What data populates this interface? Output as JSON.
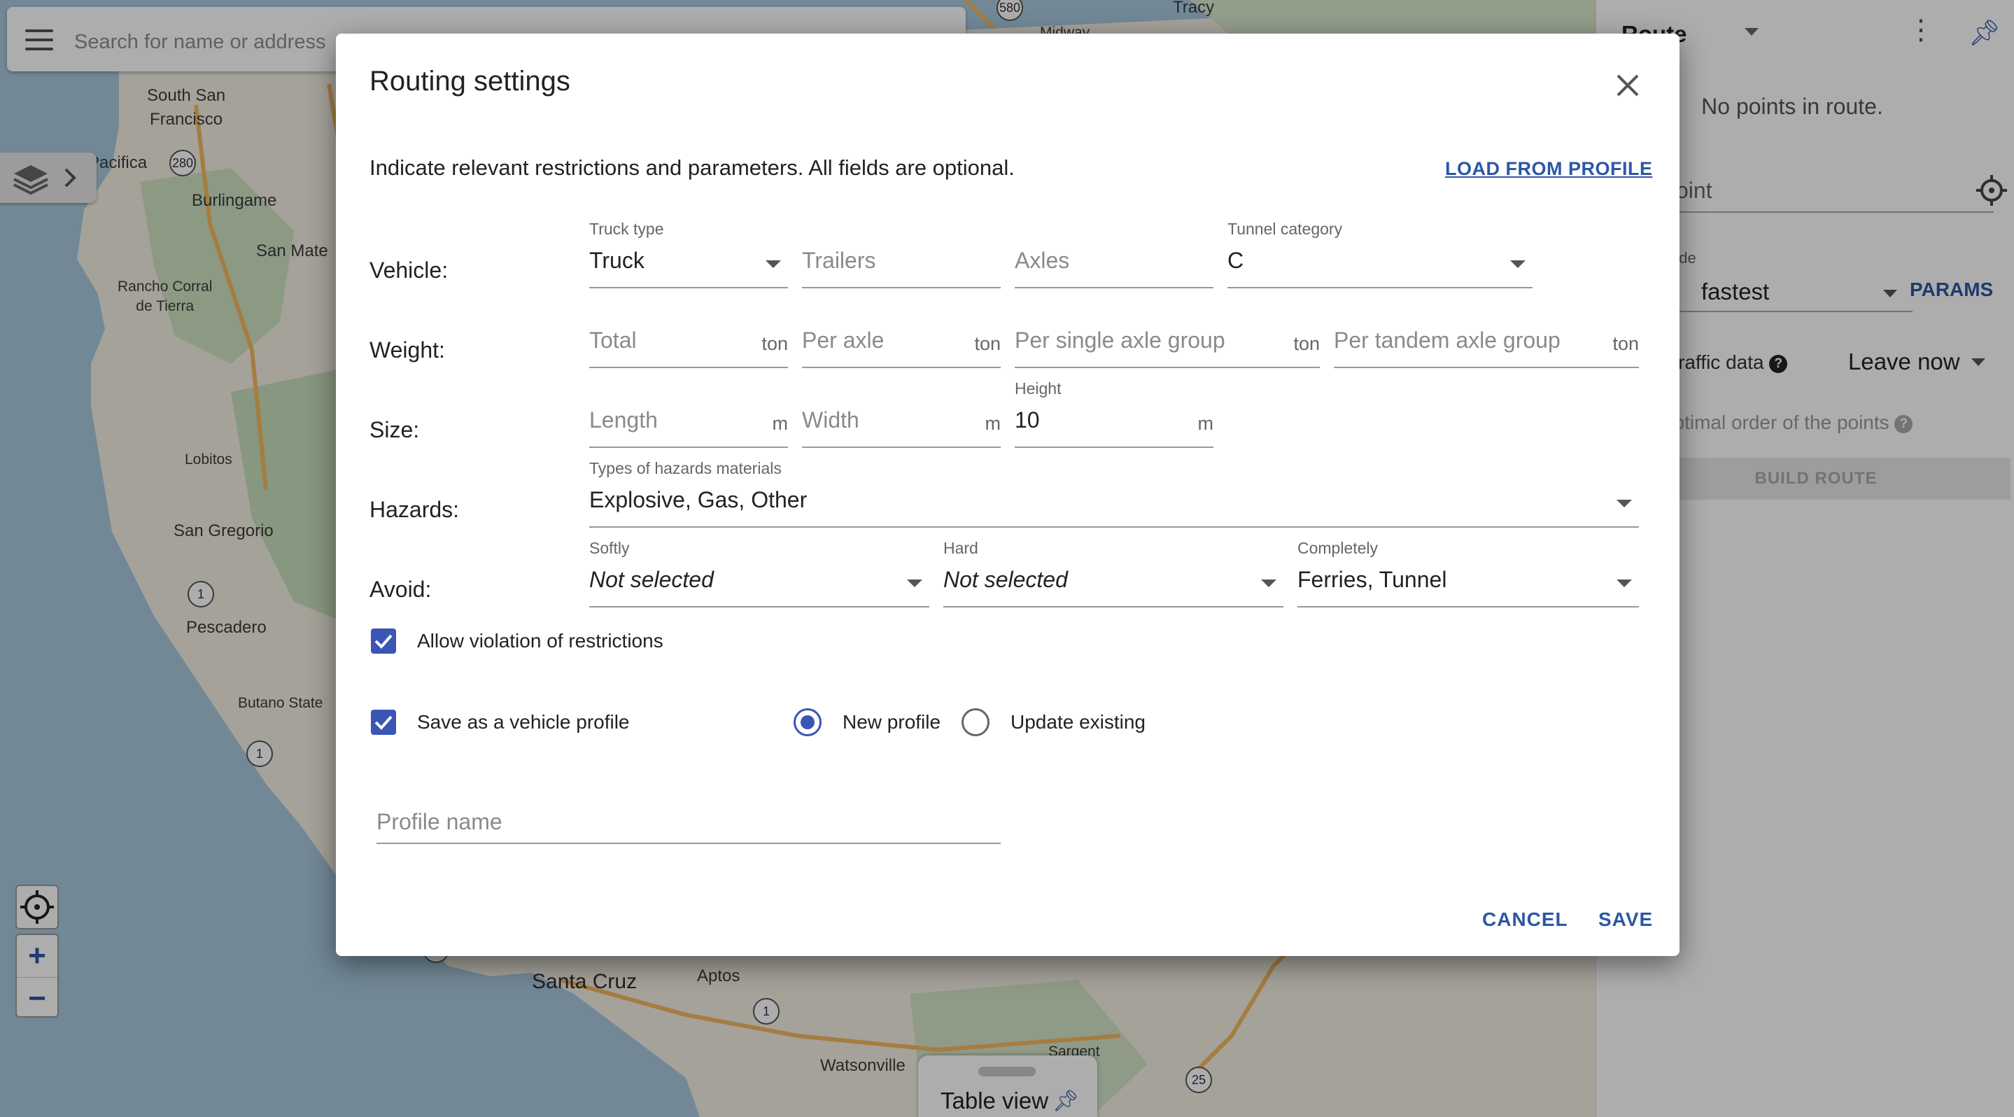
{
  "map": {
    "search_placeholder": "Search for name or address",
    "labels": {
      "south_sf": "South San\nFrancisco",
      "pacifica": "Pacifica",
      "burlingame": "Burlingame",
      "san_mateo": "San Mate",
      "rancho": "Rancho Corral\nde Tierra",
      "lobitos": "Lobitos",
      "san_gregorio": "San Gregorio",
      "pescadero": "Pescadero",
      "butano": "Butano State",
      "santa_cruz": "Santa Cruz",
      "aptos": "Aptos",
      "watsonville": "Watsonville",
      "sargent": "Sargent",
      "midway": "Midway",
      "tracy": "Tracy"
    },
    "shields": [
      "280",
      "1",
      "1",
      "1",
      "25",
      "1",
      "580"
    ],
    "table_view_label": "Table view",
    "zoom_in": "+",
    "zoom_out": "−"
  },
  "right_panel": {
    "title": "Route",
    "empty_message": "No points in route.",
    "point_placeholder": "oint",
    "mode_label": "ode",
    "mode_value": "fastest",
    "params_label": "PARAMS",
    "traffic_label": "e traffic data",
    "leave_value": "Leave now",
    "optimal_label": "nd optimal order of the points",
    "build_label": "BUILD ROUTE"
  },
  "dialog": {
    "title": "Routing settings",
    "intro": "Indicate relevant restrictions and parameters. All fields are optional.",
    "load_profile": "LOAD FROM PROFILE",
    "rows": {
      "vehicle": "Vehicle:",
      "weight": "Weight:",
      "size": "Size:",
      "hazards": "Hazards:",
      "avoid": "Avoid:"
    },
    "vehicle": {
      "truck_type_label": "Truck type",
      "truck_type_value": "Truck",
      "trailers_placeholder": "Trailers",
      "axles_placeholder": "Axles",
      "tunnel_label": "Tunnel category",
      "tunnel_value": "C"
    },
    "weight": {
      "total_placeholder": "Total",
      "per_axle_placeholder": "Per axle",
      "single_group_placeholder": "Per single axle group",
      "tandem_group_placeholder": "Per tandem axle group",
      "unit": "ton"
    },
    "size": {
      "length_placeholder": "Length",
      "width_placeholder": "Width",
      "height_label": "Height",
      "height_value": "10",
      "unit": "m"
    },
    "hazards": {
      "label": "Types of hazards materials",
      "value": "Explosive, Gas, Other"
    },
    "avoid": {
      "softly_label": "Softly",
      "softly_value": "Not selected",
      "hard_label": "Hard",
      "hard_value": "Not selected",
      "completely_label": "Completely",
      "completely_value": "Ferries, Tunnel"
    },
    "allow_violation_label": "Allow violation of restrictions",
    "allow_violation_checked": true,
    "save_profile_label": "Save as a vehicle profile",
    "save_profile_checked": true,
    "new_profile_label": "New profile",
    "update_existing_label": "Update existing",
    "selected_profile_option": "New profile",
    "profile_name_placeholder": "Profile name",
    "cancel_label": "CANCEL",
    "save_label": "SAVE"
  },
  "colors": {
    "accent": "#3a55b4",
    "link": "#2d57a5",
    "overlay": "rgba(0,0,0,0.32)"
  }
}
